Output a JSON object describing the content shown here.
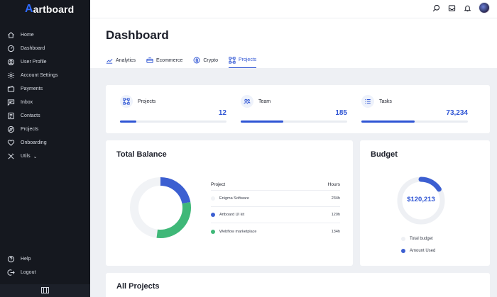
{
  "app": {
    "brand": "artboard",
    "brand_mark": "A"
  },
  "sidebar": {
    "items": [
      {
        "label": "Home",
        "icon": "home-icon"
      },
      {
        "label": "Dashboard",
        "icon": "speedometer-icon"
      },
      {
        "label": "User Profile",
        "icon": "user-circle-icon"
      },
      {
        "label": "Account Settings",
        "icon": "gear-icon"
      },
      {
        "label": "Payments",
        "icon": "wallet-icon"
      },
      {
        "label": "Inbox",
        "icon": "chat-icon"
      },
      {
        "label": "Contacts",
        "icon": "contact-book-icon"
      },
      {
        "label": "Projects",
        "icon": "compass-icon"
      },
      {
        "label": "Onboarding",
        "icon": "heart-icon"
      },
      {
        "label": "Utils",
        "icon": "tools-icon",
        "chevron": "⌄"
      }
    ],
    "bottom_items": [
      {
        "label": "Help",
        "icon": "help-icon"
      },
      {
        "label": "Logout",
        "icon": "logout-icon"
      }
    ]
  },
  "header": {
    "title": "Dashboard",
    "tabs": [
      {
        "label": "Analytics",
        "icon": "chart-icon",
        "active": false
      },
      {
        "label": "Ecommerce",
        "icon": "cart-icon",
        "active": false
      },
      {
        "label": "Crypto",
        "icon": "bitcoin-icon",
        "active": false
      },
      {
        "label": "Projects",
        "icon": "project-icon",
        "active": true
      }
    ]
  },
  "stats": [
    {
      "label": "Projects",
      "value": "12",
      "progress": 0.15
    },
    {
      "label": "Team",
      "value": "185",
      "progress": 0.4
    },
    {
      "label": "Tasks",
      "value": "73,234",
      "progress": 0.5
    }
  ],
  "balance": {
    "title": "Total Balance",
    "columns": {
      "project": "Project",
      "hours": "Hours"
    },
    "rows": [
      {
        "name": "Enigma Software",
        "hours": "234h",
        "color": "#f1f3f6"
      },
      {
        "name": "Artboard UI kit",
        "hours": "120h",
        "color": "#3c5fd1"
      },
      {
        "name": "Webflow marketplace",
        "hours": "134h",
        "color": "#3fb878"
      }
    ],
    "donut_shares": [
      0.48,
      0.22,
      0.3
    ]
  },
  "budget": {
    "title": "Budget",
    "value": "$120,213",
    "used_fraction": 0.16,
    "legend": [
      {
        "label": "Total budget",
        "color": "#eef0f4"
      },
      {
        "label": "Amount Used",
        "color": "#3c5fd1"
      }
    ]
  },
  "projects": {
    "title": "All Projects"
  },
  "colors": {
    "accent": "#2f55d4",
    "sidebar_bg": "#15181f",
    "green": "#3fb878"
  }
}
